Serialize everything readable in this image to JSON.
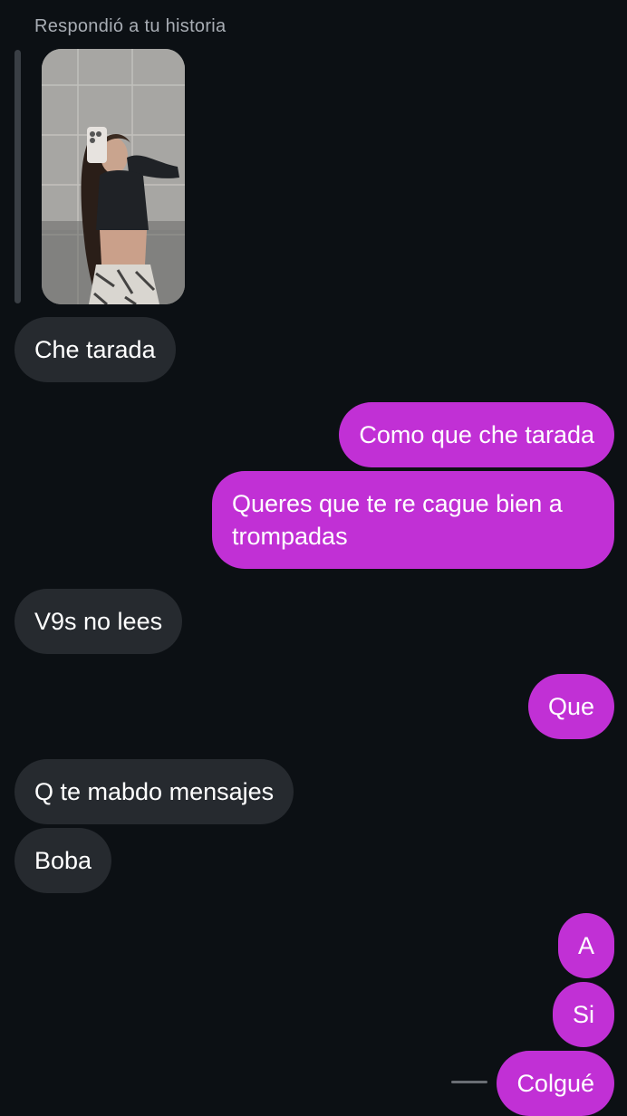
{
  "story": {
    "label": "Respondió a tu historia"
  },
  "messages": [
    {
      "side": "in",
      "text": "Che tarada"
    },
    {
      "side": "out",
      "text": "Como que che tarada"
    },
    {
      "side": "out",
      "text": "Queres que te re cague bien a trompadas"
    },
    {
      "side": "in",
      "text": "V9s no lees"
    },
    {
      "side": "out",
      "text": "Que"
    },
    {
      "side": "in",
      "text": "Q te mabdo mensajes"
    },
    {
      "side": "in",
      "text": "Boba"
    },
    {
      "side": "out",
      "text": "A"
    },
    {
      "side": "out",
      "text": "Si"
    },
    {
      "side": "out",
      "text": "Colgué"
    }
  ],
  "colors": {
    "background": "#0c1014",
    "incoming_bubble": "#262a2f",
    "outgoing_bubble": "#c130d5",
    "meta_text": "#a8adb4"
  }
}
